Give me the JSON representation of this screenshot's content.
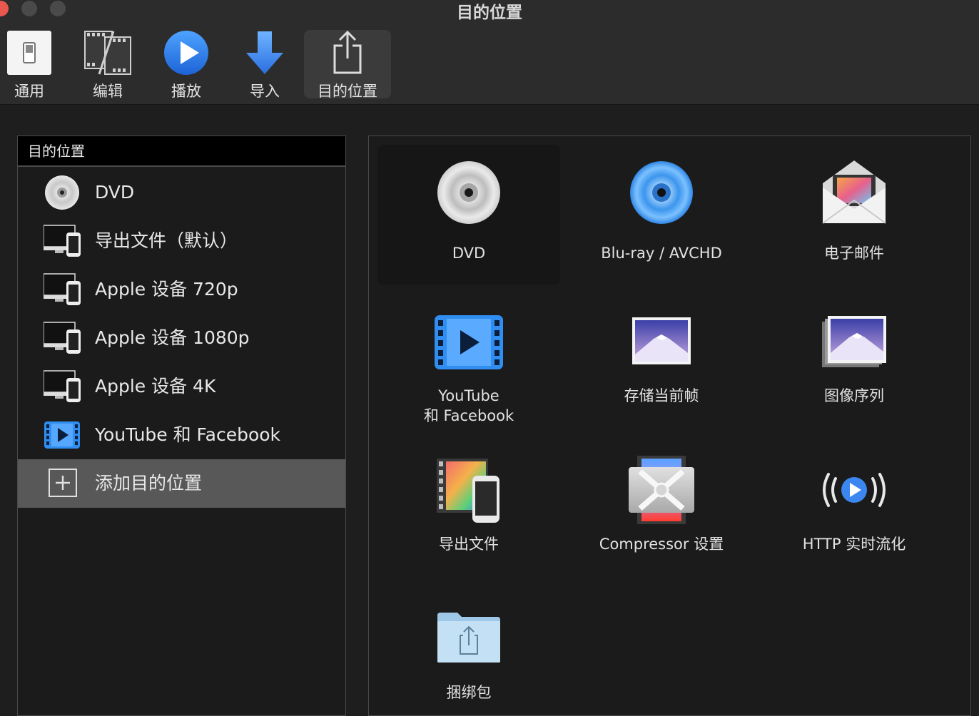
{
  "window": {
    "title": "目的位置"
  },
  "toolbar": {
    "items": [
      {
        "label": "通用",
        "icon": "switch-icon"
      },
      {
        "label": "编辑",
        "icon": "film-edit-icon"
      },
      {
        "label": "播放",
        "icon": "play-icon"
      },
      {
        "label": "导入",
        "icon": "import-arrow-icon"
      },
      {
        "label": "目的位置",
        "icon": "share-icon",
        "active": true
      }
    ]
  },
  "list": {
    "header": "目的位置",
    "items": [
      {
        "label": "DVD",
        "icon": "dvd-disc-icon"
      },
      {
        "label": "导出文件（默认）",
        "icon": "devices-icon"
      },
      {
        "label": "Apple 设备 720p",
        "icon": "devices-icon"
      },
      {
        "label": "Apple 设备 1080p",
        "icon": "devices-icon"
      },
      {
        "label": "Apple 设备 4K",
        "icon": "devices-icon"
      },
      {
        "label": "YouTube 和 Facebook",
        "icon": "video-play-icon"
      },
      {
        "label": "添加目的位置",
        "icon": "add-icon",
        "selected": true
      }
    ]
  },
  "grid": {
    "tiles": [
      {
        "label": "DVD",
        "icon": "dvd-disc-icon",
        "selected": true
      },
      {
        "label": "Blu-ray / AVCHD",
        "icon": "bluray-disc-icon"
      },
      {
        "label": "电子邮件",
        "icon": "email-icon"
      },
      {
        "label": "YouTube\n和 Facebook",
        "icon": "video-play-icon"
      },
      {
        "label": "存储当前帧",
        "icon": "photo-icon"
      },
      {
        "label": "图像序列",
        "icon": "image-sequence-icon"
      },
      {
        "label": "导出文件",
        "icon": "export-file-icon"
      },
      {
        "label": "Compressor 设置",
        "icon": "compressor-icon"
      },
      {
        "label": "HTTP 实时流化",
        "icon": "live-stream-icon"
      },
      {
        "label": "捆绑包",
        "icon": "bundle-folder-icon"
      }
    ]
  }
}
